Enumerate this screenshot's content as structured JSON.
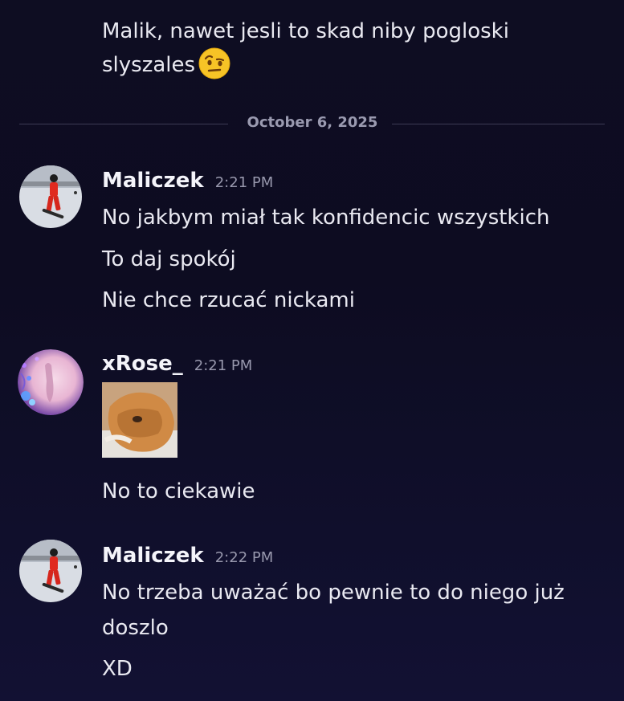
{
  "previous_message": {
    "line1": "Malik, nawet jesli to skad niby pogloski",
    "line2": "slyszales",
    "emoji_icon": "face-with-raised-eyebrow-emoji"
  },
  "date_divider": "October 6, 2025",
  "messages": [
    {
      "author": "Maliczek",
      "time": "2:21 PM",
      "lines": [
        "No jakbym miał tak konfidencic wszystkich",
        "To daj spokój",
        "Nie chce rzucać nickami"
      ]
    },
    {
      "author": "xRose_",
      "time": "2:21 PM",
      "attachment": "cat-image",
      "lines": [
        "No to ciekawie"
      ]
    },
    {
      "author": "Maliczek",
      "time": "2:22 PM",
      "lines": [
        "No trzeba uważać bo pewnie to do niego już",
        "doszlo",
        "XD"
      ]
    }
  ],
  "colors": {
    "background": "#0e0d22",
    "text": "#e9e9f1",
    "muted": "#9898ad",
    "divider": "#3c3b55"
  }
}
